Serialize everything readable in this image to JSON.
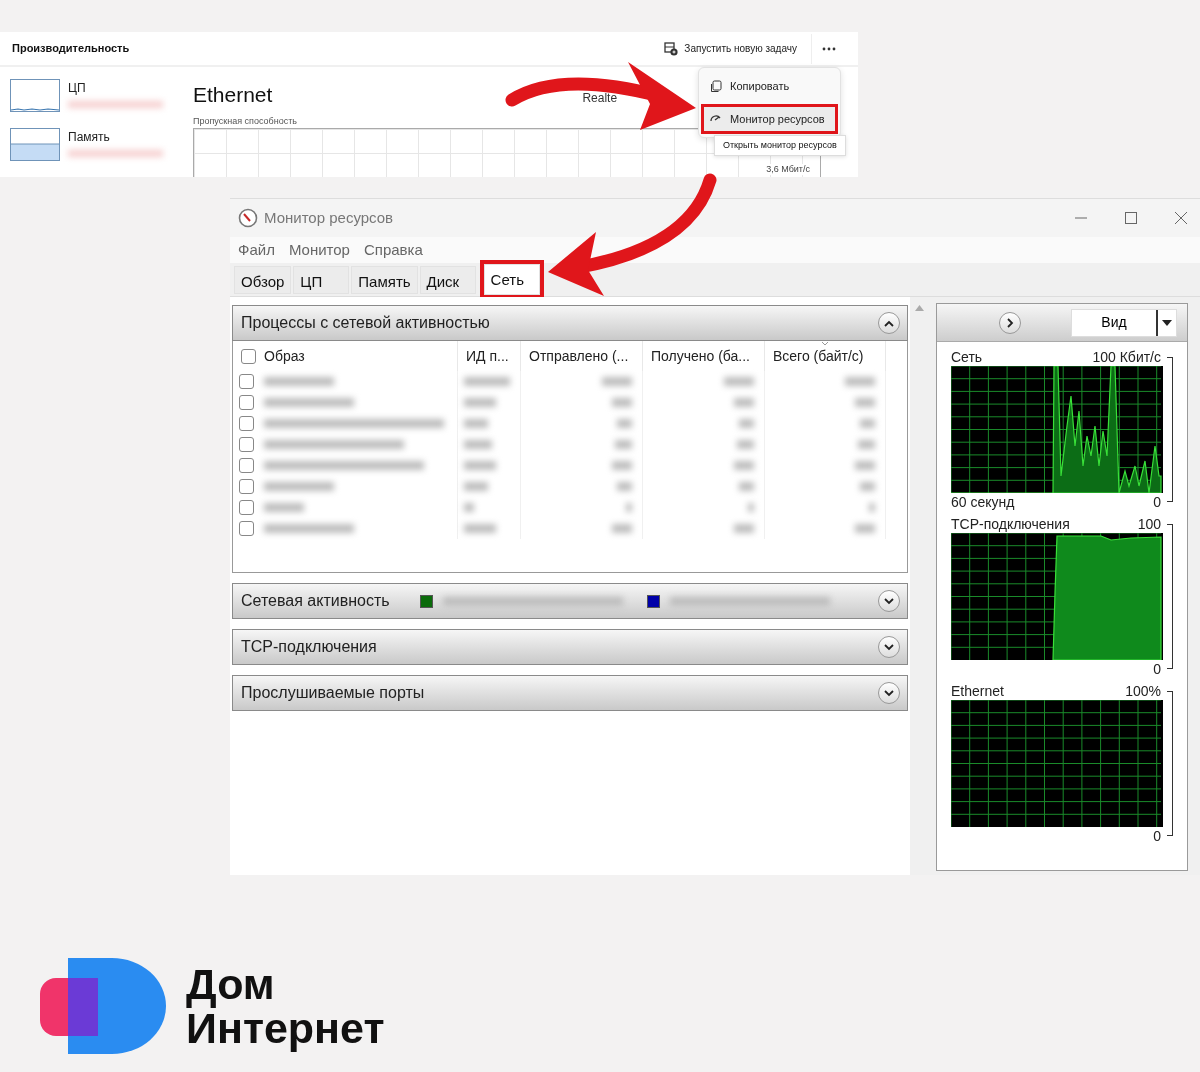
{
  "task_manager": {
    "title": "Производительность",
    "new_task_button": "Запустить новую задачу",
    "sidebar": [
      {
        "label": "ЦП",
        "kind": "cpu"
      },
      {
        "label": "Память",
        "kind": "memory"
      }
    ],
    "adapter_title": "Ethernet",
    "adapter_name": "Realte",
    "chart_label": "Пропускная способность",
    "scale_label": "3,6 Мбит/с",
    "menu": [
      {
        "label": "Копировать",
        "kind": "copy",
        "highlighted": false
      },
      {
        "label": "Монитор ресурсов",
        "kind": "monitor",
        "highlighted": true
      }
    ],
    "tooltip": "Открыть монитор ресурсов"
  },
  "resource_monitor": {
    "title": "Монитор ресурсов",
    "menu": [
      "Файл",
      "Монитор",
      "Справка"
    ],
    "tabs": [
      {
        "label": "Обзор",
        "selected": false,
        "highlighted": false
      },
      {
        "label": "ЦП",
        "selected": false,
        "highlighted": false
      },
      {
        "label": "Память",
        "selected": false,
        "highlighted": false
      },
      {
        "label": "Диск",
        "selected": false,
        "highlighted": false
      },
      {
        "label": "Сеть",
        "selected": true,
        "highlighted": true
      }
    ],
    "sections": [
      {
        "title": "Процессы с сетевой активностью",
        "kind": "processes",
        "expanded": true
      },
      {
        "title": "Сетевая активность",
        "kind": "activity",
        "expanded": false
      },
      {
        "title": "TCP-подключения",
        "kind": "plain",
        "expanded": false
      },
      {
        "title": "Прослушиваемые порты",
        "kind": "plain",
        "expanded": false
      }
    ],
    "process_table": {
      "header_checked": false,
      "columns": [
        "Образ",
        "ИД п...",
        "Отправлено (...",
        "Получено (ба...",
        "Всего (байт/с)"
      ],
      "rows": [
        {
          "checked": false
        },
        {
          "checked": false
        },
        {
          "checked": false
        },
        {
          "checked": false
        },
        {
          "checked": false
        },
        {
          "checked": false
        },
        {
          "checked": false
        },
        {
          "checked": false
        }
      ]
    },
    "activity_legend": [
      {
        "color": "#0b6b0b"
      },
      {
        "color": "#0000a8"
      }
    ],
    "view_button": "Вид",
    "graphs": [
      {
        "title": "Сеть",
        "top_value": "100 Кбит/с",
        "bottom_label": "60 секунд",
        "bottom_value": "0",
        "kind": "spiky"
      },
      {
        "title": "TCP-подключения",
        "top_value": "100",
        "bottom_value": "0",
        "kind": "plateau"
      },
      {
        "title": "Ethernet",
        "top_value": "100%",
        "bottom_value": "0",
        "kind": "empty"
      }
    ]
  },
  "logo": {
    "lines": [
      "Дом",
      "Интернет"
    ]
  }
}
